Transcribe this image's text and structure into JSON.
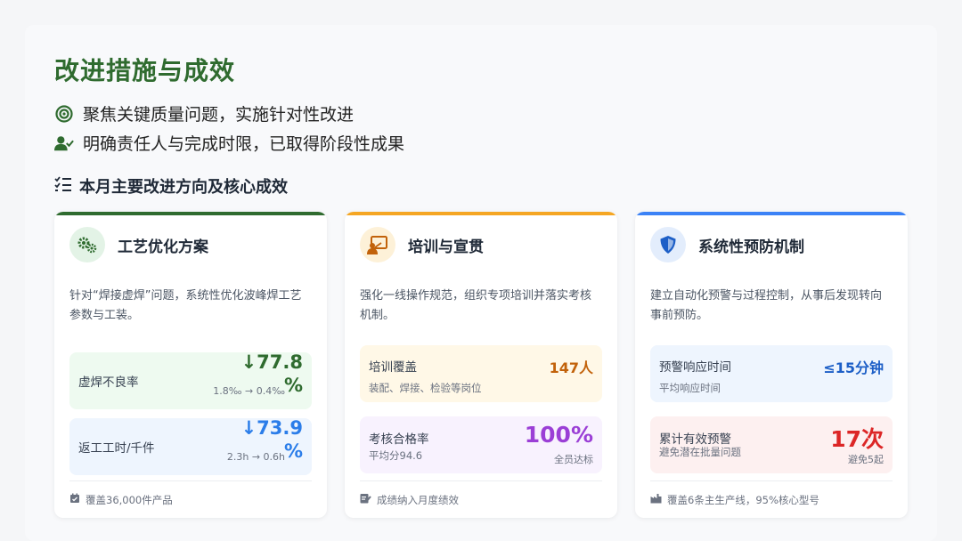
{
  "page": {
    "title": "改进措施与成效",
    "bullets": [
      {
        "icon": "target-icon",
        "text": "聚焦关键质量问题，实施针对性改进"
      },
      {
        "icon": "user-check-icon",
        "text": "明确责任人与完成时限，已取得阶段性成果"
      }
    ],
    "section_title": "本月主要改进方向及核心成效"
  },
  "cards": [
    {
      "accent": "#2f6b2f",
      "icon": "gears-icon",
      "title": "工艺优化方案",
      "desc": "针对“焊接虚焊”问题，系统性优化波峰焊工艺参数与工装。",
      "metrics": [
        {
          "label": "虚焊不良率",
          "value": "↓77.8",
          "value_tail": "%",
          "note": "1.8‰ → 0.4‰",
          "color": "#2f6b2f"
        },
        {
          "label": "返工工时/千件",
          "value": "↓73.9",
          "value_tail": "%",
          "note": "2.3h → 0.6h",
          "color": "#2b7de9"
        }
      ],
      "footer": "覆盖36,000件产品"
    },
    {
      "accent": "#f5a623",
      "icon": "presentation-icon",
      "title": "培训与宣贯",
      "desc": "强化一线操作规范，组织专项培训并落实考核机制。",
      "metrics": [
        {
          "label": "培训覆盖",
          "sub": "装配、焊接、检验等岗位",
          "value": "147人",
          "color": "#c2620a"
        },
        {
          "label": "考核合格率",
          "sub": "平均分94.6",
          "value": "100%",
          "note": "全员达标",
          "color": "#9b3fd6"
        }
      ],
      "footer": "成绩纳入月度绩效"
    },
    {
      "accent": "#3b82f6",
      "icon": "shield-icon",
      "title": "系统性预防机制",
      "desc": "建立自动化预警与过程控制，从事后发现转向事前预防。",
      "metrics": [
        {
          "label": "预警响应时间",
          "sub": "平均响应时间",
          "value": "≤15分钟",
          "color": "#1d5fc7"
        },
        {
          "label": "累计有效预警",
          "sub": "避免潜在批量问题",
          "value": "17次",
          "note": "避免5起",
          "color": "#dc2626"
        }
      ],
      "footer": "覆盖6条主生产线，95%核心型号"
    }
  ]
}
